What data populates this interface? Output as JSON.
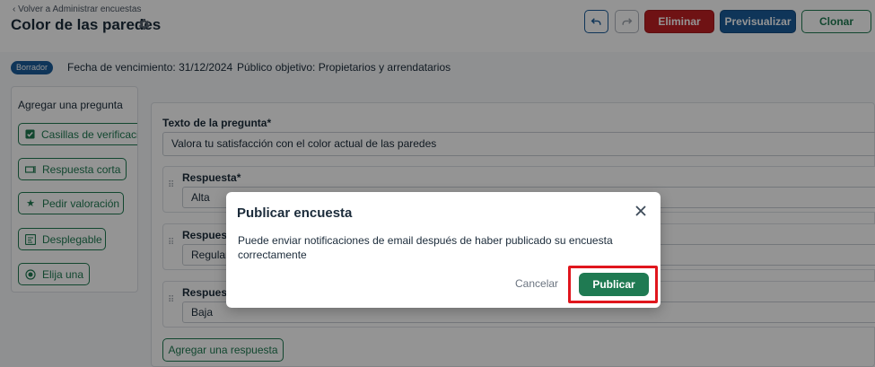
{
  "header": {
    "back_link": "Volver a Administrar encuestas",
    "title": "Color de las paredes",
    "buttons": {
      "undo_icon": "undo-icon",
      "redo_icon": "redo-icon",
      "delete": "Eliminar",
      "preview": "Previsualizar",
      "clone": "Clonar"
    }
  },
  "status": {
    "badge": "Borrador",
    "due_date": "Fecha de vencimiento: 31/12/2024",
    "audience": "Público objetivo: Propietarios y arrendatarios"
  },
  "question_types": {
    "title": "Agregar una pregunta",
    "items": [
      {
        "label": "Casillas de verificación",
        "icon": "checkbox-icon"
      },
      {
        "label": "Respuesta corta",
        "icon": "short-answer-icon"
      },
      {
        "label": "Pedir valoración",
        "icon": "star-icon"
      },
      {
        "label": "Desplegable",
        "icon": "dropdown-icon"
      },
      {
        "label": "Elija una",
        "icon": "radio-icon"
      }
    ]
  },
  "question": {
    "label": "Texto de la pregunta*",
    "text": "Valora tu satisfacción con el color actual de las paredes",
    "answers": [
      {
        "label": "Respuesta*",
        "value": "Alta"
      },
      {
        "label": "Respuesta*",
        "value": "Regular"
      },
      {
        "label": "Respuesta*",
        "value": "Baja"
      }
    ],
    "add_answer": "Agregar una respuesta"
  },
  "modal": {
    "title": "Publicar encuesta",
    "body": "Puede enviar notificaciones de email después de haber publicado su encuesta correctamente",
    "cancel": "Cancelar",
    "publish": "Publicar"
  },
  "colors": {
    "primary_blue": "#1a5c9a",
    "green": "#1f7a52",
    "danger": "#c01f24",
    "highlight": "#e0161d"
  }
}
